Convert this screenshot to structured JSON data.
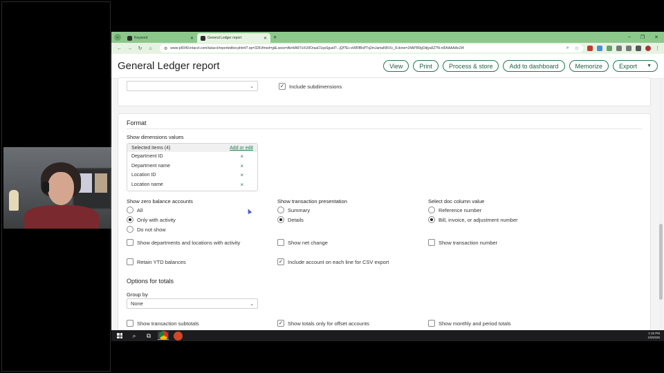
{
  "browser": {
    "tabs": [
      {
        "title": "Keyword",
        "active": false
      },
      {
        "title": "General Ledger report",
        "active": true
      }
    ],
    "new_tab": "+",
    "url": "www-p5049.intacct.com/ia/acct/reporteditor.phtml?.op=328.ifmod=gl&.sess=Ale4iAR7sXU9OraaO1qsSguid?...jQf?Ec-eWRfBsPTq2mJamaNfXXc_8.done=24APR9gOdjya5Z?N-nlFAAAAAo2I4"
  },
  "header": {
    "title": "General Ledger report",
    "buttons": [
      "View",
      "Print",
      "Process & store",
      "Add to dashboard",
      "Memorize",
      "Export"
    ]
  },
  "top_panel": {
    "select_value": "",
    "include_subdimensions": {
      "label": "Include subdimensions",
      "checked": true
    }
  },
  "format": {
    "title": "Format",
    "show_dimensions_label": "Show dimensions values",
    "selected_items_label": "Selected items (4)",
    "add_or_edit": "Add or edit",
    "dimensions": [
      "Department ID",
      "Department name",
      "Location ID",
      "Location name"
    ],
    "remove_glyph": "×",
    "zero_balance": {
      "label": "Show zero balance accounts",
      "options": [
        "All",
        "Only with activity",
        "Do not show"
      ],
      "selected": 1
    },
    "transaction_presentation": {
      "label": "Show transaction presentation",
      "options": [
        "Summary",
        "Details"
      ],
      "selected": 1
    },
    "doc_column": {
      "label": "Select doc column value",
      "options": [
        "Reference number",
        "Bill, invoice, or adjustment number"
      ],
      "selected": 1
    },
    "checkboxes_row1": [
      {
        "label": "Show departments and locations with activity",
        "checked": false
      },
      {
        "label": "Show net change",
        "checked": false
      },
      {
        "label": "Show transaction number",
        "checked": false
      }
    ],
    "checkboxes_row2": [
      {
        "label": "Retain YTD balances",
        "checked": false
      },
      {
        "label": "Include account on each line for CSV export",
        "checked": true
      }
    ]
  },
  "totals": {
    "title": "Options for totals",
    "group_by_label": "Group by",
    "group_by_value": "None",
    "checkboxes": [
      {
        "label": "Show transaction subtotals",
        "checked": false
      },
      {
        "label": "Show totals only for offset accounts",
        "checked": true
      },
      {
        "label": "Show monthly and period totals",
        "checked": false
      }
    ]
  },
  "taskbar": {
    "time": "1:15 PM",
    "date": "1/8/2025"
  },
  "colors": {
    "accent": "#1e7a4e",
    "chrome": "#8cc78c"
  }
}
